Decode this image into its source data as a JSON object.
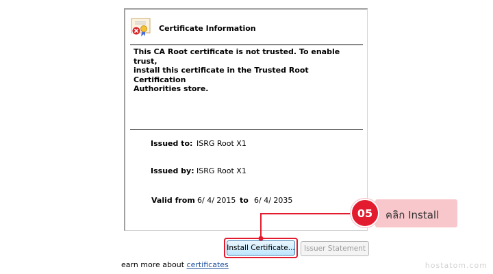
{
  "certificate": {
    "title": "Certificate Information",
    "message": "This CA Root certificate is not trusted. To enable trust,\ninstall this certificate in the Trusted Root Certification\nAuthorities store.",
    "issued_to_label": "Issued to:",
    "issued_to_value": "ISRG Root X1",
    "issued_by_label": "Issued by:",
    "issued_by_value": "ISRG Root X1",
    "valid_from_label": "Valid from",
    "valid_from_value": "6/ 4/ 2015",
    "valid_to_label": "to",
    "valid_to_value": "6/ 4/ 2035"
  },
  "buttons": {
    "install": "Install Certificate...",
    "issuer_statement": "Issuer Statement"
  },
  "learn_more": {
    "text": "earn more about ",
    "link": "certificates"
  },
  "callout": {
    "step": "05",
    "text": "คลิก Install",
    "accent": "#e21b2e",
    "box_color": "#f8c7cc"
  },
  "watermark": "hostatom.com",
  "icons": {
    "certificate": "certificate-error-icon"
  }
}
